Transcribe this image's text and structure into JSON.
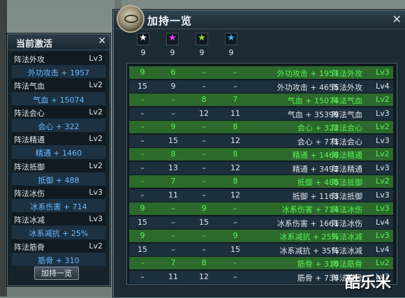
{
  "left_panel": {
    "title": "当前激活",
    "close_glyph": "✕",
    "rows": [
      {
        "name": "阵法外攻",
        "level": "Lv3"
      },
      {
        "bonus": "外功攻击 + 1957"
      },
      {
        "name": "阵法气血",
        "level": "Lv2"
      },
      {
        "bonus": "气血 + 15074"
      },
      {
        "name": "阵法会心",
        "level": "Lv2"
      },
      {
        "bonus": "会心 + 322"
      },
      {
        "name": "阵法精通",
        "level": "Lv2"
      },
      {
        "bonus": "精通 + 1460"
      },
      {
        "name": "阵法抵御",
        "level": "Lv2"
      },
      {
        "bonus": "抵御 + 488"
      },
      {
        "name": "阵法冰伤",
        "level": "Lv3"
      },
      {
        "bonus": "冰系伤害 + 714"
      },
      {
        "name": "阵法冰减",
        "level": "Lv3"
      },
      {
        "bonus": "冰系减抗 + 25%"
      },
      {
        "name": "阵法筋骨",
        "level": "Lv2"
      },
      {
        "bonus": "筋骨 + 310"
      }
    ],
    "button_label": "加持一览"
  },
  "main_panel": {
    "title": "加持一览",
    "close_glyph": "✕",
    "gems": [
      {
        "icon": "white-star-gem-icon",
        "color": "#ffffff",
        "count": "9"
      },
      {
        "icon": "magenta-star-gem-icon",
        "color": "#e040ff",
        "count": "9"
      },
      {
        "icon": "green-star-gem-icon",
        "color": "#8ddc2a",
        "count": "9"
      },
      {
        "icon": "blue-star-gem-icon",
        "color": "#34b4ff",
        "count": "9"
      }
    ],
    "rows": [
      {
        "style": "green",
        "c": [
          "9",
          "6",
          "–",
          "–",
          "外功攻击 + 1957",
          "阵法外攻",
          "Lv3"
        ]
      },
      {
        "style": "dark",
        "c": [
          "15",
          "9",
          "–",
          "–",
          "外功攻击 + 4655",
          "阵法外攻",
          "Lv4"
        ]
      },
      {
        "style": "green",
        "c": [
          "–",
          "–",
          "8",
          "7",
          "气血 + 15074",
          "阵法气血",
          "Lv2"
        ]
      },
      {
        "style": "dark",
        "c": [
          "–",
          "–",
          "12",
          "11",
          "气血 + 35399",
          "阵法气血",
          "Lv3"
        ]
      },
      {
        "style": "green",
        "c": [
          "–",
          "9",
          "–",
          "8",
          "会心 + 322",
          "阵法会心",
          "Lv2"
        ]
      },
      {
        "style": "dark",
        "c": [
          "–",
          "15",
          "–",
          "12",
          "会心 + 771",
          "阵法会心",
          "Lv3"
        ]
      },
      {
        "style": "green",
        "c": [
          "–",
          "8",
          "–",
          "8",
          "精通 + 1460",
          "阵法精通",
          "Lv2"
        ]
      },
      {
        "style": "dark",
        "c": [
          "–",
          "13",
          "–",
          "12",
          "精通 + 3492",
          "阵法精通",
          "Lv3"
        ]
      },
      {
        "style": "green",
        "c": [
          "–",
          "7",
          "–",
          "8",
          "抵御 + 488",
          "阵法抵御",
          "Lv2"
        ]
      },
      {
        "style": "dark",
        "c": [
          "–",
          "11",
          "–",
          "12",
          "抵御 + 1163",
          "阵法抵御",
          "Lv3"
        ]
      },
      {
        "style": "green",
        "c": [
          "9",
          "–",
          "9",
          "–",
          "冰系伤害 + 714",
          "阵法冰伤",
          "Lv3"
        ]
      },
      {
        "style": "dark",
        "c": [
          "15",
          "–",
          "15",
          "–",
          "冰系伤害 + 1661",
          "阵法冰伤",
          "Lv4"
        ]
      },
      {
        "style": "green",
        "c": [
          "9",
          "–",
          "–",
          "9",
          "冰系减抗 + 25%",
          "阵法冰减",
          "Lv3"
        ]
      },
      {
        "style": "dark",
        "c": [
          "15",
          "–",
          "–",
          "15",
          "冰系减抗 + 35%",
          "阵法冰减",
          "Lv4"
        ]
      },
      {
        "style": "green",
        "c": [
          "–",
          "7",
          "8",
          "–",
          "筋骨 + 310",
          "阵法筋骨",
          "Lv2"
        ]
      },
      {
        "style": "dark",
        "c": [
          "–",
          "11",
          "12",
          "–",
          "筋骨 + 739",
          "阵法筋骨",
          "Lv3"
        ]
      }
    ]
  },
  "watermark": "酷乐米"
}
